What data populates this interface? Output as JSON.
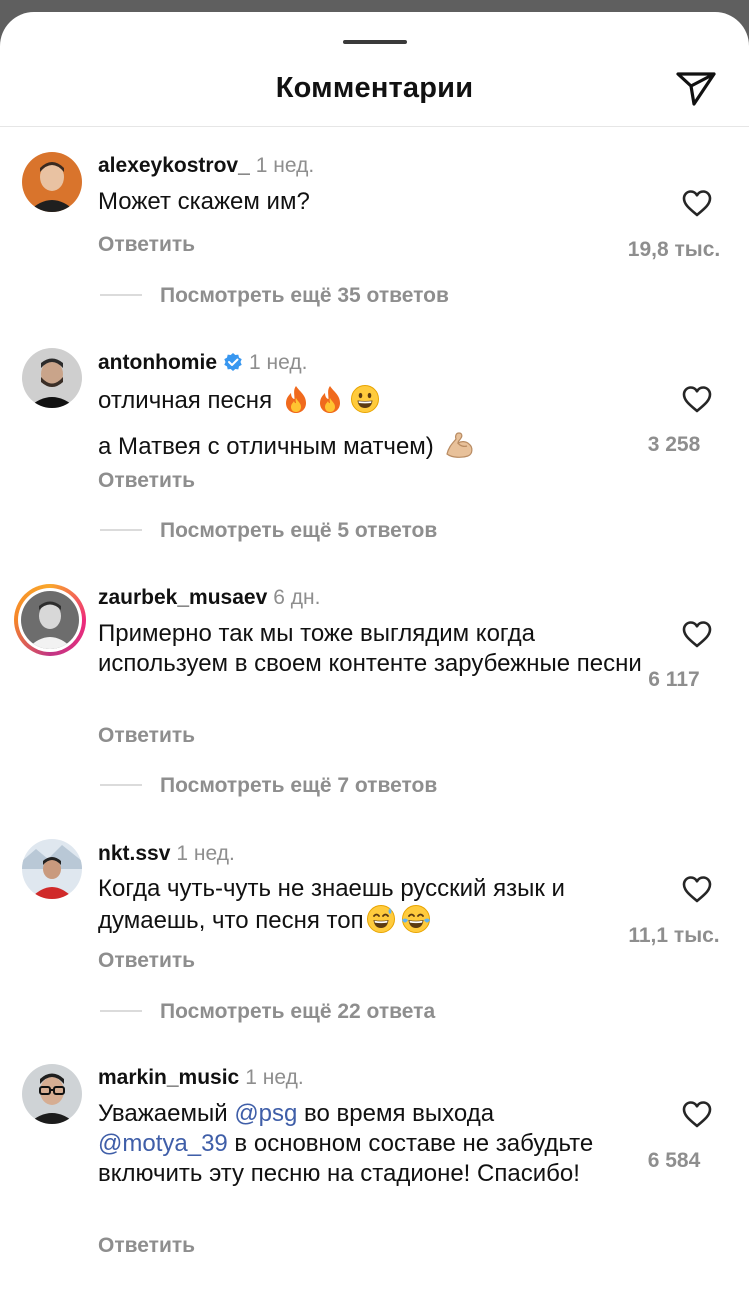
{
  "header": {
    "title": "Комментарии"
  },
  "comments": [
    {
      "username": "alexeykostrov_",
      "time": "1 нед.",
      "text": "Может скажем им?",
      "reply_label": "Ответить",
      "likes": "19,8 тыс.",
      "more_replies": "Посмотреть ещё 35 ответов"
    },
    {
      "username": "antonhomie",
      "verified": true,
      "time": "1 нед.",
      "text_line1": "отличная песня",
      "text_line2": "а Матвея с отличным матчем)",
      "reply_label": "Ответить",
      "likes": "3 258",
      "more_replies": "Посмотреть ещё 5 ответов"
    },
    {
      "username": "zaurbek_musaev",
      "time": "6 дн.",
      "text": "Примерно так мы тоже выглядим когда используем в своем контенте зарубежные песни",
      "reply_label": "Ответить",
      "likes": "6 117",
      "more_replies": "Посмотреть ещё 7 ответов"
    },
    {
      "username": "nkt.ssv",
      "time": "1 нед.",
      "text_line1": "Когда чуть-чуть не знаешь русский язык и",
      "text_line2": "думаешь, что песня топ",
      "reply_label": "Ответить",
      "likes": "11,1 тыс.",
      "more_replies": "Посмотреть ещё 22 ответа"
    },
    {
      "username": "markin_music",
      "time": "1 нед.",
      "text_part1": "Уважаемый ",
      "mention1": "@psg",
      "text_part2": " во время выхода",
      "mention2": "@motya_39",
      "text_part3": " в основном составе не забудьте включить эту песню на стадионе! Спасибо!",
      "reply_label": "Ответить",
      "likes": "6 584"
    }
  ],
  "icons": {
    "share": "paper-plane-icon",
    "like": "heart-outline-icon",
    "verified": "verified-badge-icon"
  },
  "colors": {
    "mention": "#3f5ea8",
    "verified": "#3897f0",
    "secondary_text": "#8e8e8e"
  }
}
